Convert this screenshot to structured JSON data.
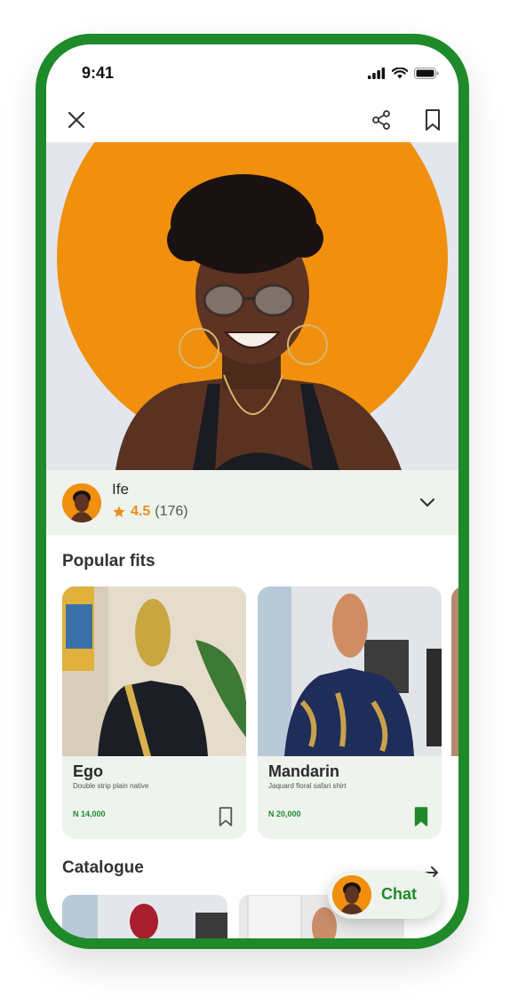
{
  "status_bar": {
    "time": "9:41"
  },
  "profile": {
    "name": "Ife",
    "rating": "4.5",
    "reviews": "(176)"
  },
  "sections": {
    "popular": "Popular fits",
    "catalogue": "Catalogue"
  },
  "fits": [
    {
      "name": "Ego",
      "description": "Double strip plain native",
      "price": "N 14,000",
      "saved": false
    },
    {
      "name": "Mandarin",
      "description": "Jaquard floral safari shirt",
      "price": "N 20,000",
      "saved": true
    }
  ],
  "chat": {
    "label": "Chat"
  },
  "colors": {
    "brand_green": "#1f8a2a",
    "accent_orange": "#f0900e",
    "star": "#e6911b",
    "card_bg": "#eef3ee"
  },
  "icons": [
    "close-icon",
    "share-icon",
    "bookmark-icon",
    "chevron-down-icon",
    "star-icon",
    "arrow-right-icon",
    "signal-icon",
    "wifi-icon",
    "battery-icon"
  ]
}
